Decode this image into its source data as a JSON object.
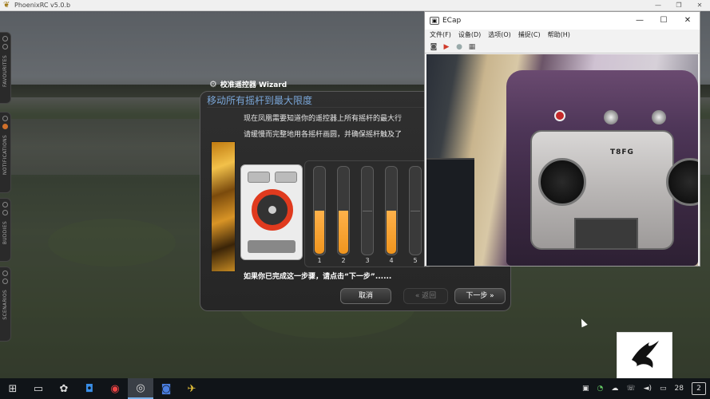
{
  "window": {
    "title": "PhoenixRC v5.0.b",
    "controls": [
      "—",
      "❐",
      "✕"
    ]
  },
  "side_tabs": [
    {
      "label": "FAVOURITES"
    },
    {
      "label": "NOTIFICATIONS"
    },
    {
      "label": "BUDDIES"
    },
    {
      "label": "SCENARIOS"
    }
  ],
  "wizard": {
    "title": "校准遥控器 Wizard",
    "banner": "移动所有摇杆到最大限度",
    "line1": "现在凤凰需要知道你的遥控器上所有摇杆的最大行",
    "line2": "请缓慢而完整地用各摇杆画圆，并确保摇杆触及了",
    "prompt": "如果你已完成这一步骤，请点击“下一步”......",
    "buttons": {
      "cancel": "取消",
      "back": "« 返回",
      "next": "下一步 »"
    },
    "channels": [
      {
        "label": "1",
        "level": 0.5
      },
      {
        "label": "2",
        "level": 0.5
      },
      {
        "label": "3",
        "level": 0.0
      },
      {
        "label": "4",
        "level": 0.5
      },
      {
        "label": "5",
        "level": 0.0
      }
    ]
  },
  "ecap": {
    "title": "ECap",
    "controls": [
      "—",
      "☐",
      "✕"
    ],
    "menu": [
      "文件(F)",
      "设备(D)",
      "选项(O)",
      "捕捉(C)",
      "帮助(H)"
    ],
    "video_label": "T8FG"
  },
  "taskbar": {
    "apps": [
      "start",
      "task-view",
      "app-1",
      "app-2",
      "chrome",
      "phoenix",
      "app-3",
      "app-4"
    ],
    "clock": "28",
    "notifications": "2"
  },
  "colors": {
    "accent_orange": "#f0951e",
    "banner_blue": "#7aa6d8"
  }
}
